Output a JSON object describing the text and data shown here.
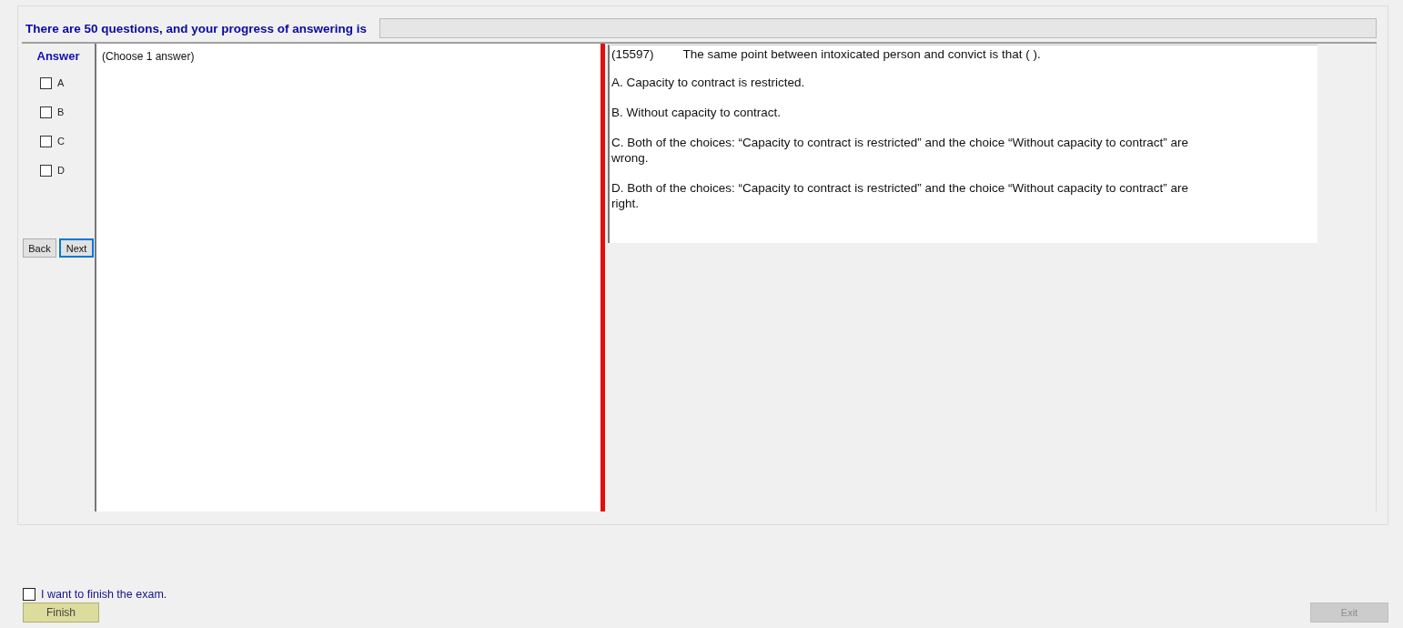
{
  "header": {
    "text": "There are 50 questions, and your progress of answering is",
    "progress": {
      "level": 0
    }
  },
  "answer_panel": {
    "title": "Answer",
    "options": [
      {
        "label": "A",
        "checked": false
      },
      {
        "label": "B",
        "checked": false
      },
      {
        "label": "C",
        "checked": false
      },
      {
        "label": "D",
        "checked": false
      }
    ],
    "buttons": [
      {
        "label": "Back",
        "focused": false
      },
      {
        "label": "Next",
        "focused": true
      }
    ]
  },
  "answer_box": {
    "hint": "(Choose 1 answer)"
  },
  "question": {
    "number": "(15597)",
    "text": "The same point between intoxicated person and convict is that (      ).",
    "choices": [
      "A.  Capacity to contract is restricted.",
      "B.  Without capacity to contract.",
      "C.  Both of the choices: “Capacity to contract is restricted” and the choice “Without capacity to contract” are wrong.",
      "D.  Both of the choices: “Capacity to contract is restricted” and the choice “Without capacity to contract”  are right."
    ]
  },
  "finish": {
    "label": "I want to finish the exam.",
    "checked": false,
    "button": "Finish"
  },
  "exit_button": {
    "label": "Exit",
    "disabled": true
  }
}
